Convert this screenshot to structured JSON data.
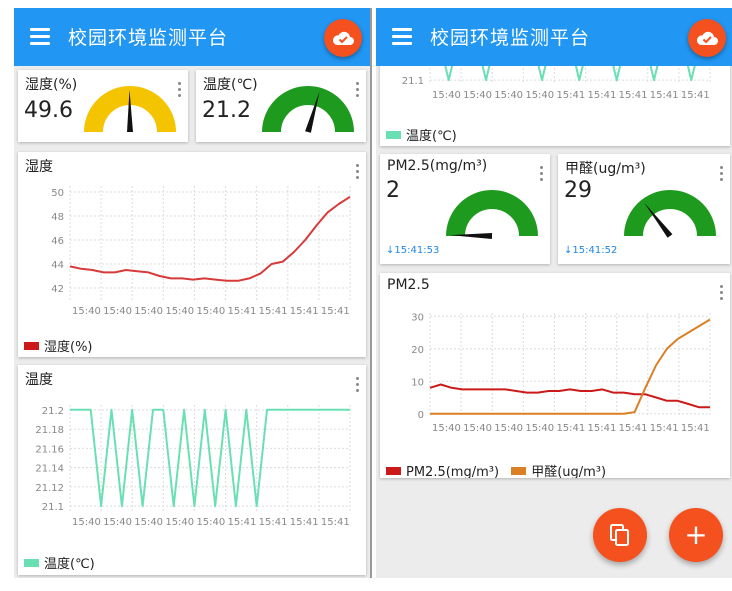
{
  "app": {
    "title": "校园环境监测平台"
  },
  "colors": {
    "primary": "#2196f3",
    "accent": "#f4511e",
    "humidity_line": "#d83a3a",
    "temp_line": "#69e0b4",
    "pm25": "#cc1a1a",
    "formaldehyde": "#d98026",
    "gauge_yellow": "#f5c400",
    "gauge_green": "#1e9a1e",
    "time_blue": "#1e88e5"
  },
  "icons": {
    "menu": "menu-icon",
    "cloud": "cloud-check-icon",
    "more": "more-vert-icon",
    "copy": "copy-icon",
    "add": "plus-icon",
    "arrow": "arrow-down-icon"
  },
  "left": {
    "humidity_card": {
      "title": "湿度(%)",
      "value": "49.6"
    },
    "temp_card": {
      "title": "温度(℃)",
      "value": "21.2"
    },
    "humidity_chart": {
      "title": "湿度",
      "legend": "湿度(%)"
    },
    "temp_chart": {
      "title": "温度",
      "legend": "温度(℃)"
    }
  },
  "right": {
    "temp_legend": "温度(℃)",
    "pm25_card": {
      "title": "PM2.5(mg/m³)",
      "value": "2",
      "time": "15:41:53"
    },
    "hcho_card": {
      "title": "甲醛(ug/m³)",
      "value": "29",
      "time": "15:41:52"
    },
    "pm_chart": {
      "title": "PM2.5",
      "legend_pm": "PM2.5(mg/m³)",
      "legend_hcho": "甲醛(ug/m³)"
    }
  },
  "chart_data": [
    {
      "id": "humidity",
      "type": "line",
      "title": "湿度",
      "x_tick_labels": [
        "15:40",
        "15:40",
        "15:40",
        "15:40",
        "15:40",
        "15:41",
        "15:41",
        "15:41",
        "15:41"
      ],
      "y_ticks": [
        42,
        44,
        46,
        48,
        50
      ],
      "ylim": [
        41,
        50.5
      ],
      "grid": true,
      "series": [
        {
          "name": "湿度(%)",
          "color": "#d83a3a",
          "values": [
            43.8,
            43.6,
            43.5,
            43.3,
            43.3,
            43.5,
            43.4,
            43.3,
            43.0,
            42.8,
            42.8,
            42.7,
            42.8,
            42.7,
            42.6,
            42.6,
            42.8,
            43.2,
            44.0,
            44.2,
            45.0,
            46.0,
            47.2,
            48.3,
            49.0,
            49.6
          ]
        }
      ]
    },
    {
      "id": "temperature",
      "type": "line",
      "title": "温度",
      "x_tick_labels": [
        "15:40",
        "15:40",
        "15:40",
        "15:40",
        "15:40",
        "15:41",
        "15:41",
        "15:41",
        "15:41"
      ],
      "y_ticks": [
        21.1,
        21.12,
        21.14,
        21.16,
        21.18,
        21.2
      ],
      "ylim": [
        21.095,
        21.205
      ],
      "grid": true,
      "series": [
        {
          "name": "温度(℃)",
          "color": "#69e0b4",
          "values": [
            21.2,
            21.2,
            21.2,
            21.1,
            21.2,
            21.1,
            21.2,
            21.1,
            21.2,
            21.2,
            21.1,
            21.2,
            21.1,
            21.2,
            21.1,
            21.2,
            21.1,
            21.2,
            21.1,
            21.2,
            21.2,
            21.2,
            21.2,
            21.2,
            21.2,
            21.2,
            21.2,
            21.2
          ]
        }
      ]
    },
    {
      "id": "temperature-right",
      "type": "line",
      "title": "",
      "x_tick_labels": [
        "15:40",
        "15:40",
        "15:40",
        "15:40",
        "15:41",
        "15:41",
        "15:41",
        "15:41",
        "15:41"
      ],
      "y_ticks": [
        21.1
      ],
      "ylim": [
        21.095,
        21.205
      ],
      "grid": true,
      "series": [
        {
          "name": "温度(℃)",
          "color": "#69e0b4",
          "values": [
            21.2,
            21.1,
            21.2,
            21.1,
            21.2,
            21.2,
            21.1,
            21.2,
            21.1,
            21.2,
            21.1,
            21.2,
            21.1,
            21.2,
            21.1,
            21.2
          ]
        }
      ]
    },
    {
      "id": "pm",
      "type": "line",
      "title": "PM2.5",
      "x_tick_labels": [
        "15:40",
        "15:40",
        "15:40",
        "15:40",
        "15:41",
        "15:41",
        "15:41",
        "15:41",
        "15:41"
      ],
      "y_ticks": [
        0,
        10,
        20,
        30
      ],
      "ylim": [
        -1,
        31
      ],
      "grid": true,
      "series": [
        {
          "name": "PM2.5(mg/m³)",
          "color": "#cc1a1a",
          "values": [
            8,
            9,
            8,
            7.5,
            7.5,
            7.5,
            7.5,
            7.5,
            7,
            6.5,
            6.5,
            7,
            7,
            7.5,
            7,
            7,
            7.5,
            6.5,
            6.5,
            6,
            6,
            5,
            4,
            4,
            3,
            2,
            2
          ]
        },
        {
          "name": "甲醛(ug/m³)",
          "color": "#d98026",
          "values": [
            0,
            0,
            0,
            0,
            0,
            0,
            0,
            0,
            0,
            0,
            0,
            0,
            0,
            0,
            0,
            0,
            0,
            0,
            0,
            0.5,
            8,
            15,
            20,
            23,
            25,
            27,
            29
          ]
        }
      ]
    }
  ],
  "gauges": [
    {
      "id": "humidity-gauge",
      "value": 49.6,
      "min": 0,
      "max": 100,
      "color": "#f5c400"
    },
    {
      "id": "temp-gauge",
      "value": 21.2,
      "min": -20,
      "max": 50,
      "color": "#1e9a1e"
    },
    {
      "id": "pm-gauge",
      "value": 2,
      "min": 0,
      "max": 300,
      "color": "#1e9a1e"
    },
    {
      "id": "hcho-gauge",
      "value": 29,
      "min": 0,
      "max": 100,
      "color": "#1e9a1e"
    }
  ]
}
